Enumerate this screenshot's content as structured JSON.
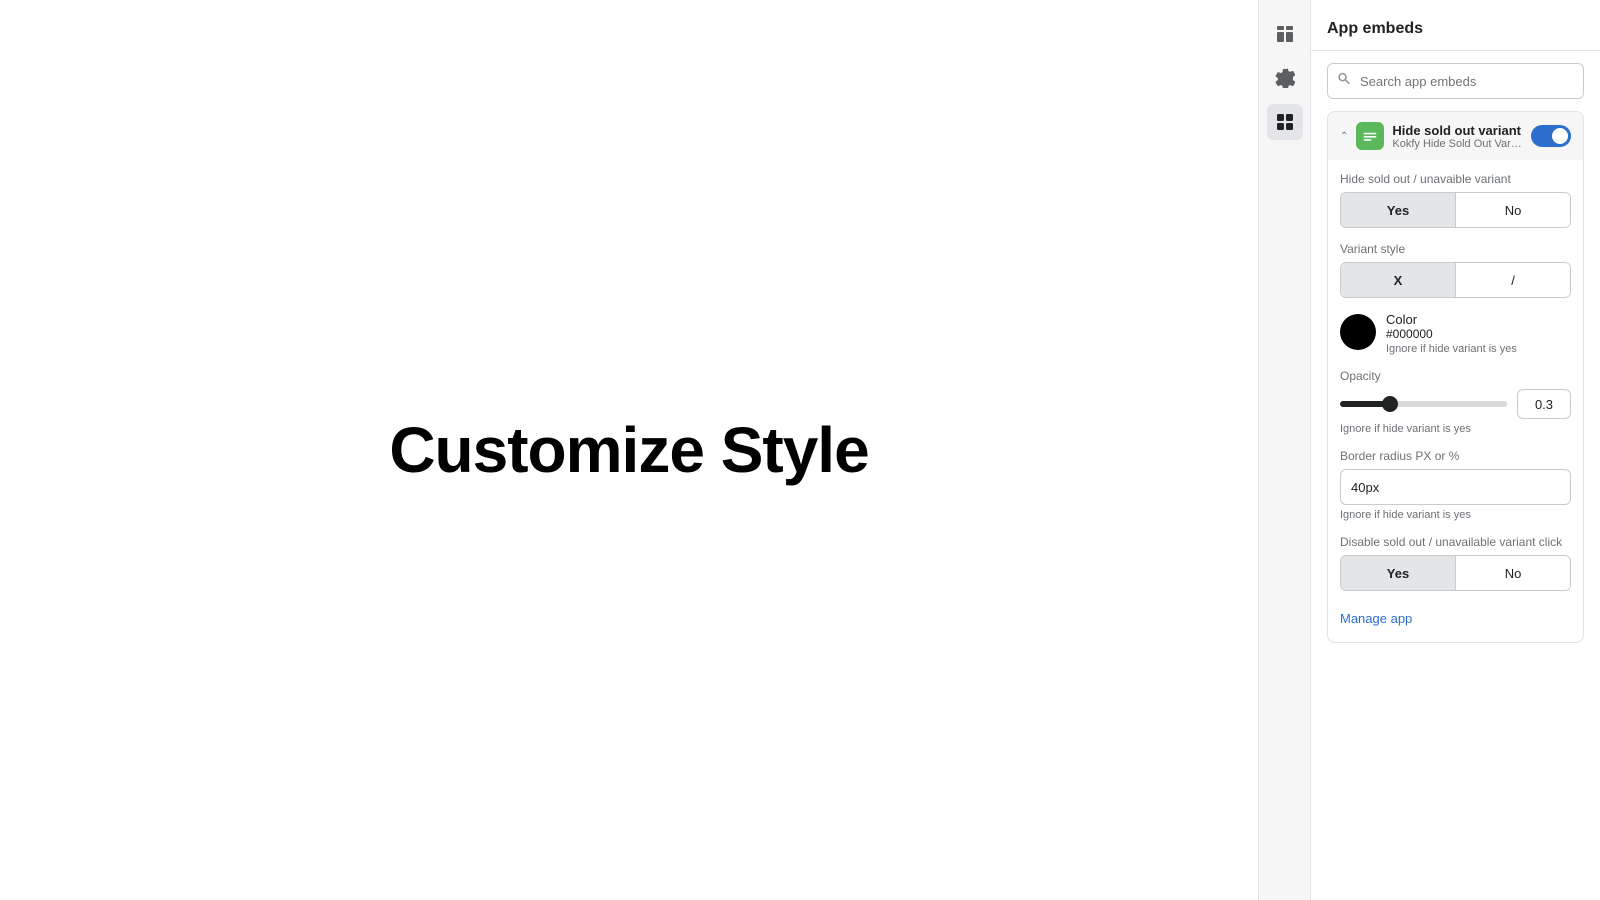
{
  "main": {
    "title": "Customize Style"
  },
  "header": {
    "title": "App embeds"
  },
  "search": {
    "placeholder": "Search app embeds"
  },
  "embed": {
    "name": "Hide sold out variant",
    "subtitle": "Kokfy Hide Sold Out Varia...",
    "enabled": true
  },
  "settings": {
    "hide_label": "Hide sold out / unavaible variant",
    "hide_yes": "Yes",
    "hide_no": "No",
    "variant_style_label": "Variant style",
    "variant_x": "X",
    "variant_slash": "/",
    "color_label": "Color",
    "color_hex": "#000000",
    "color_note": "Ignore if hide variant is yes",
    "opacity_label": "Opacity",
    "opacity_value": "0.3",
    "opacity_note": "Ignore if hide variant is yes",
    "border_radius_label": "Border radius PX or %",
    "border_radius_value": "40px",
    "border_radius_note": "Ignore if hide variant is yes",
    "disable_label": "Disable sold out / unavailable variant click",
    "disable_yes": "Yes",
    "disable_no": "No"
  },
  "manage_app": {
    "label": "Manage app"
  },
  "icons": {
    "layout_icon": "⊞",
    "gear_icon": "⚙",
    "apps_icon": "⊞",
    "search_glyph": "🔍",
    "chevron_down": "›"
  }
}
